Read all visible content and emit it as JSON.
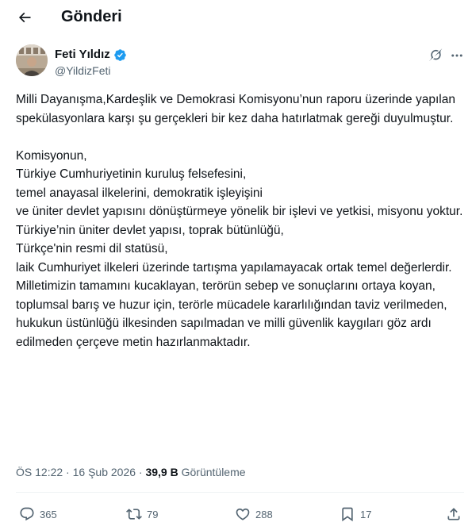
{
  "header": {
    "title": "Gönderi",
    "back_icon": "arrow-left-icon"
  },
  "author": {
    "name": "Feti Yıldız",
    "handle": "@YildizFeti",
    "verified": true,
    "verified_color": "#1d9bf0"
  },
  "tweet": {
    "paragraph1": "Milli Dayanışma,Kardeşlik ve Demokrasi Komisyonu’nun raporu üzerinde yapılan spekülasyonlara karşı şu gerçekleri bir kez daha hatırlatmak gereği duyulmuştur.",
    "lines": [
      "Komisyonun,",
      "Türkiye Cumhuriyetinin kuruluş felsefesini,",
      "temel anayasal ilkelerini, demokratik işleyişini",
      "ve üniter devlet yapısını dönüştürmeye yönelik bir işlevi ve yetkisi, misyonu yoktur.",
      "Türkiye’nin üniter devlet yapısı, toprak bütünlüğü,",
      "Türkçe'nin resmi dil statüsü,",
      "laik Cumhuriyet ilkeleri üzerinde tartışma yapılamayacak ortak temel değerlerdir.",
      "Milletimizin tamamını kucaklayan, terörün sebep ve sonuçlarını ortaya koyan,",
      "toplumsal barış ve huzur için, terörle mücadele kararlılığından taviz verilmeden,",
      "hukukun üstünlüğü ilkesinden sapılmadan ve milli güvenlik kaygıları göz ardı edilmeden çerçeve metin hazırlanmaktadır."
    ]
  },
  "meta": {
    "time": "ÖS 12:22",
    "separator": "·",
    "date": "16 Şub 2026",
    "views_count": "39,9 B",
    "views_label": "Görüntüleme"
  },
  "actions": {
    "replies": "365",
    "reposts": "79",
    "likes": "288",
    "bookmarks": "17"
  },
  "colors": {
    "text": "#0f1419",
    "secondary": "#536471",
    "accent": "#1d9bf0",
    "divider": "#eff3f4"
  }
}
